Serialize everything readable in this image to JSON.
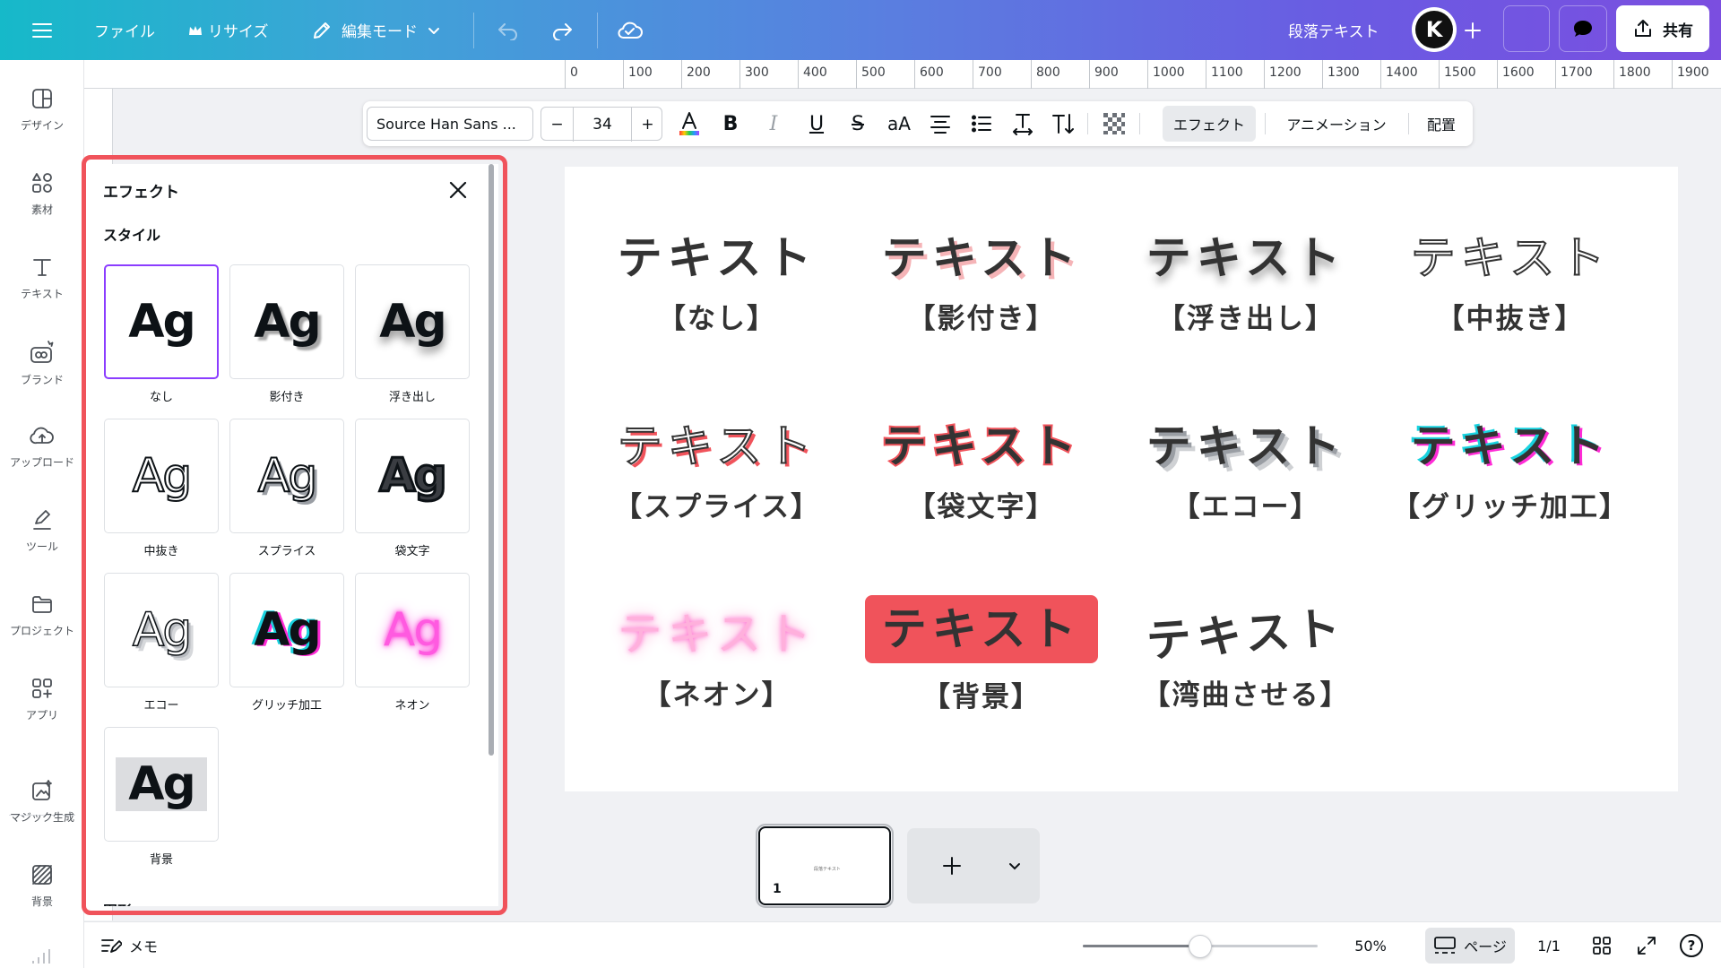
{
  "topbar": {
    "file_label": "ファイル",
    "resize_label": "リサイズ",
    "edit_mode_label": "編集モード",
    "doc_title": "段落テキスト",
    "avatar_letter": "K",
    "share_label": "共有"
  },
  "rail": {
    "items": [
      {
        "label": "デザイン",
        "icon": "design-icon"
      },
      {
        "label": "素材",
        "icon": "elements-icon"
      },
      {
        "label": "テキスト",
        "icon": "text-icon"
      },
      {
        "label": "ブランド",
        "icon": "brand-icon"
      },
      {
        "label": "アップロード",
        "icon": "upload-icon"
      },
      {
        "label": "ツール",
        "icon": "tools-icon"
      },
      {
        "label": "プロジェクト",
        "icon": "folder-icon"
      },
      {
        "label": "アプリ",
        "icon": "apps-icon"
      },
      {
        "label": "マジック生成",
        "icon": "magic-icon"
      },
      {
        "label": "背景",
        "icon": "background-icon"
      }
    ]
  },
  "ruler": [
    "0",
    "100",
    "200",
    "300",
    "400",
    "500",
    "600",
    "700",
    "800",
    "900",
    "1000",
    "1100",
    "1200",
    "1300",
    "1400",
    "1500",
    "1600",
    "1700",
    "1800",
    "1900"
  ],
  "toolbar": {
    "font_name": "Source Han Sans ...",
    "font_size": "34",
    "minus": "−",
    "plus": "+",
    "case_label": "aA",
    "effects_label": "エフェクト",
    "animation_label": "アニメーション",
    "position_label": "配置"
  },
  "panel": {
    "title": "エフェクト",
    "style_heading": "スタイル",
    "next_heading": "図形",
    "tile_text": "Ag",
    "styles": [
      {
        "label": "なし",
        "selected": true
      },
      {
        "label": "影付き",
        "selected": false
      },
      {
        "label": "浮き出し",
        "selected": false
      },
      {
        "label": "中抜き",
        "selected": false
      },
      {
        "label": "スプライス",
        "selected": false
      },
      {
        "label": "袋文字",
        "selected": false
      },
      {
        "label": "エコー",
        "selected": false
      },
      {
        "label": "グリッチ加工",
        "selected": false
      },
      {
        "label": "ネオン",
        "selected": false
      },
      {
        "label": "背景",
        "selected": false
      }
    ]
  },
  "canvas": {
    "main_text": "テキスト",
    "captions": [
      "【なし】",
      "【影付き】",
      "【浮き出し】",
      "【中抜き】",
      "【スプライス】",
      "【袋文字】",
      "【エコー】",
      "【グリッチ加工】",
      "【ネオン】",
      "【背景】",
      "【湾曲させる】"
    ],
    "colors": {
      "text": "#333333",
      "accent_red": "#f0535b",
      "pink": "#ff8fc8",
      "cyan": "#19d3e0",
      "magenta": "#ff2bd6"
    }
  },
  "pages": {
    "thumb_number": "1",
    "thumb_text": "段落テキスト"
  },
  "bottombar": {
    "notes_label": "メモ",
    "zoom": "50%",
    "zoom_fraction": 0.5,
    "pages_label": "ページ",
    "page_count": "1/1",
    "help": "?"
  },
  "colors": {
    "highlight_outline": "#f0535b",
    "selected_tile_border": "#8b3dff"
  }
}
